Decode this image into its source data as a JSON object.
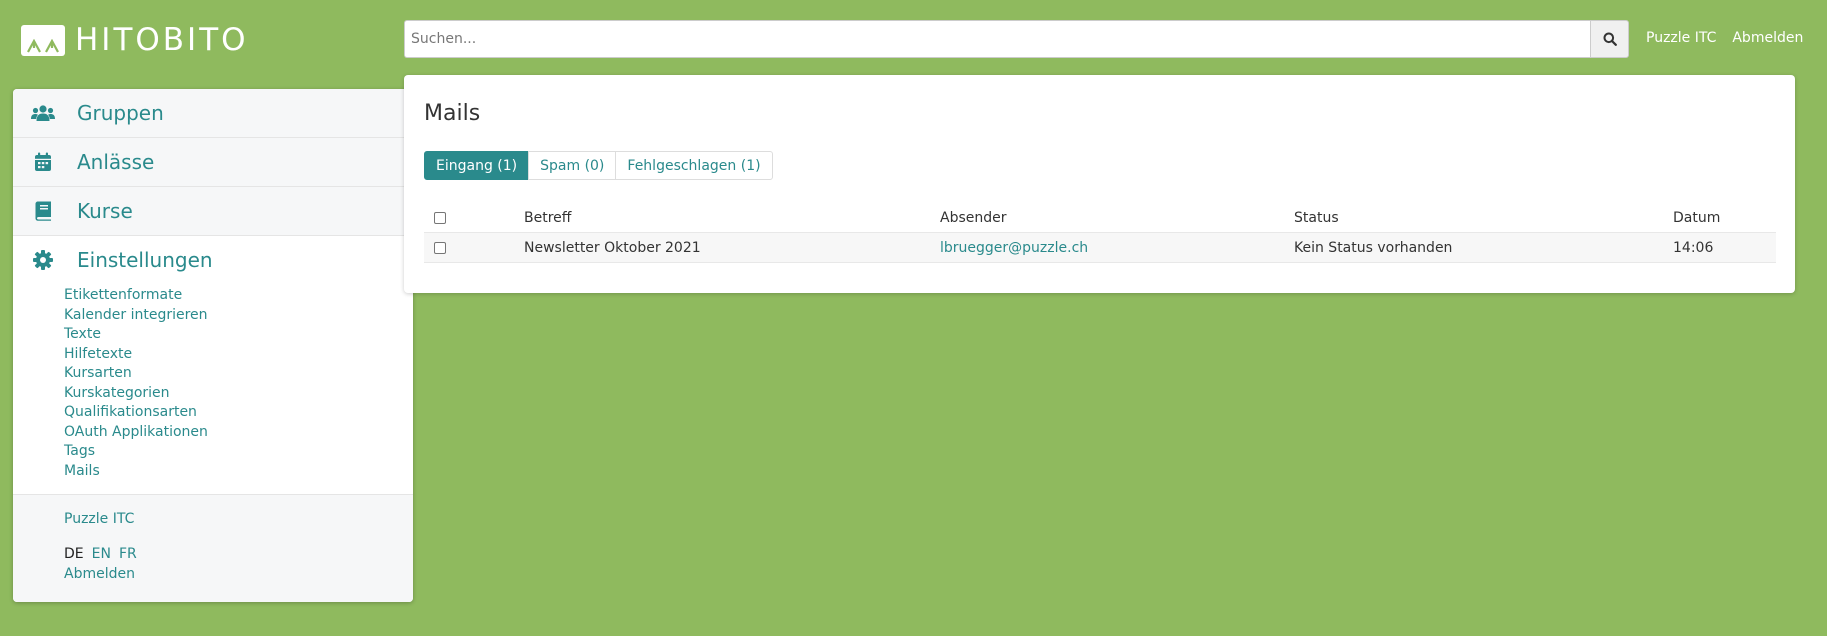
{
  "header": {
    "logo_text": "HITOBITO",
    "search_placeholder": "Suchen...",
    "links": [
      "Puzzle ITC",
      "Abmelden"
    ]
  },
  "sidebar": {
    "nav": [
      {
        "label": "Gruppen",
        "icon": "users-icon"
      },
      {
        "label": "Anlässe",
        "icon": "calendar-icon"
      },
      {
        "label": "Kurse",
        "icon": "book-icon"
      },
      {
        "label": "Einstellungen",
        "icon": "gear-icon"
      }
    ],
    "settings_items": [
      "Etikettenformate",
      "Kalender integrieren",
      "Texte",
      "Hilfetexte",
      "Kursarten",
      "Kurskategorien",
      "Qualifikationsarten",
      "OAuth Applikationen",
      "Tags",
      "Mails"
    ],
    "footer": {
      "org": "Puzzle ITC",
      "languages": [
        "DE",
        "EN",
        "FR"
      ],
      "logout": "Abmelden"
    }
  },
  "main": {
    "title": "Mails",
    "tabs": [
      "Eingang (1)",
      "Spam (0)",
      "Fehlgeschlagen (1)"
    ],
    "table": {
      "headers": [
        "Betreff",
        "Absender",
        "Status",
        "Datum"
      ],
      "rows": [
        {
          "subject": "Newsletter Oktober 2021",
          "sender": "lbruegger@puzzle.ch",
          "status": "Kein Status vorhanden",
          "date": "14:06"
        }
      ]
    }
  },
  "colors": {
    "background": "#8fba5e",
    "accent": "#2a8a8c"
  }
}
